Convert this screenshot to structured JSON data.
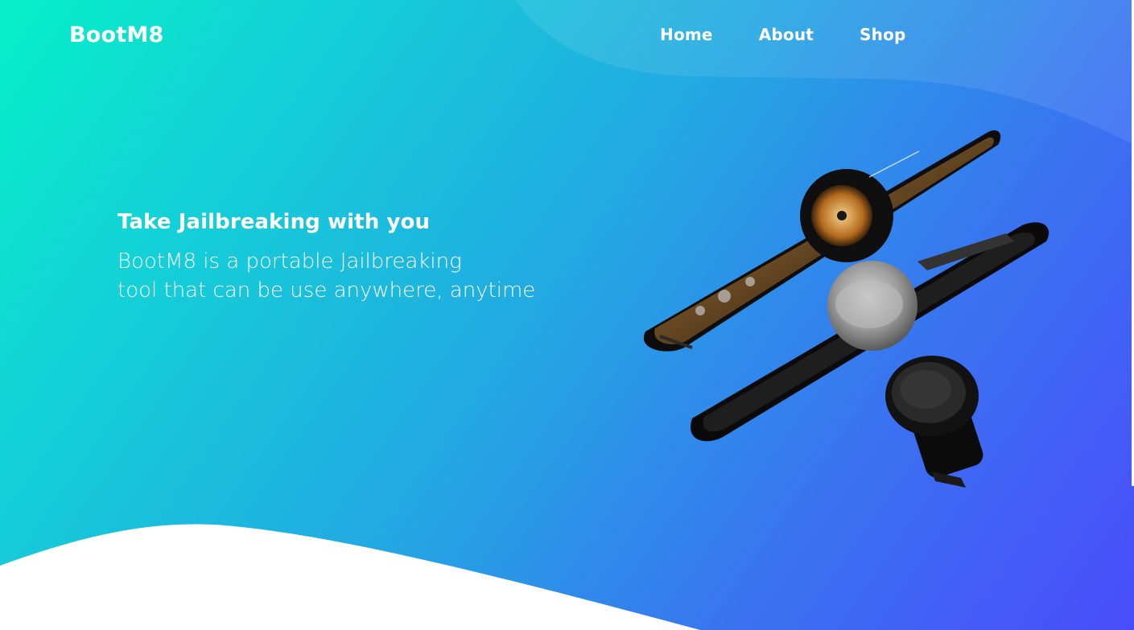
{
  "header": {
    "logo": "BootM8",
    "nav": [
      {
        "label": "Home"
      },
      {
        "label": "About"
      },
      {
        "label": "Shop"
      }
    ]
  },
  "hero": {
    "headline": "Take Jailbreaking with you",
    "description_lines": [
      "BootM8 is a portable Jailbreaking",
      "tool that can be use anywhere, anytime"
    ]
  },
  "colors": {
    "gradient_start": "#06f0c8",
    "gradient_end": "#4a4cfb",
    "text": "#ffffff",
    "wave": "#ffffff"
  },
  "icons": {
    "product": "phone-with-magnetic-case-and-car-mount"
  }
}
